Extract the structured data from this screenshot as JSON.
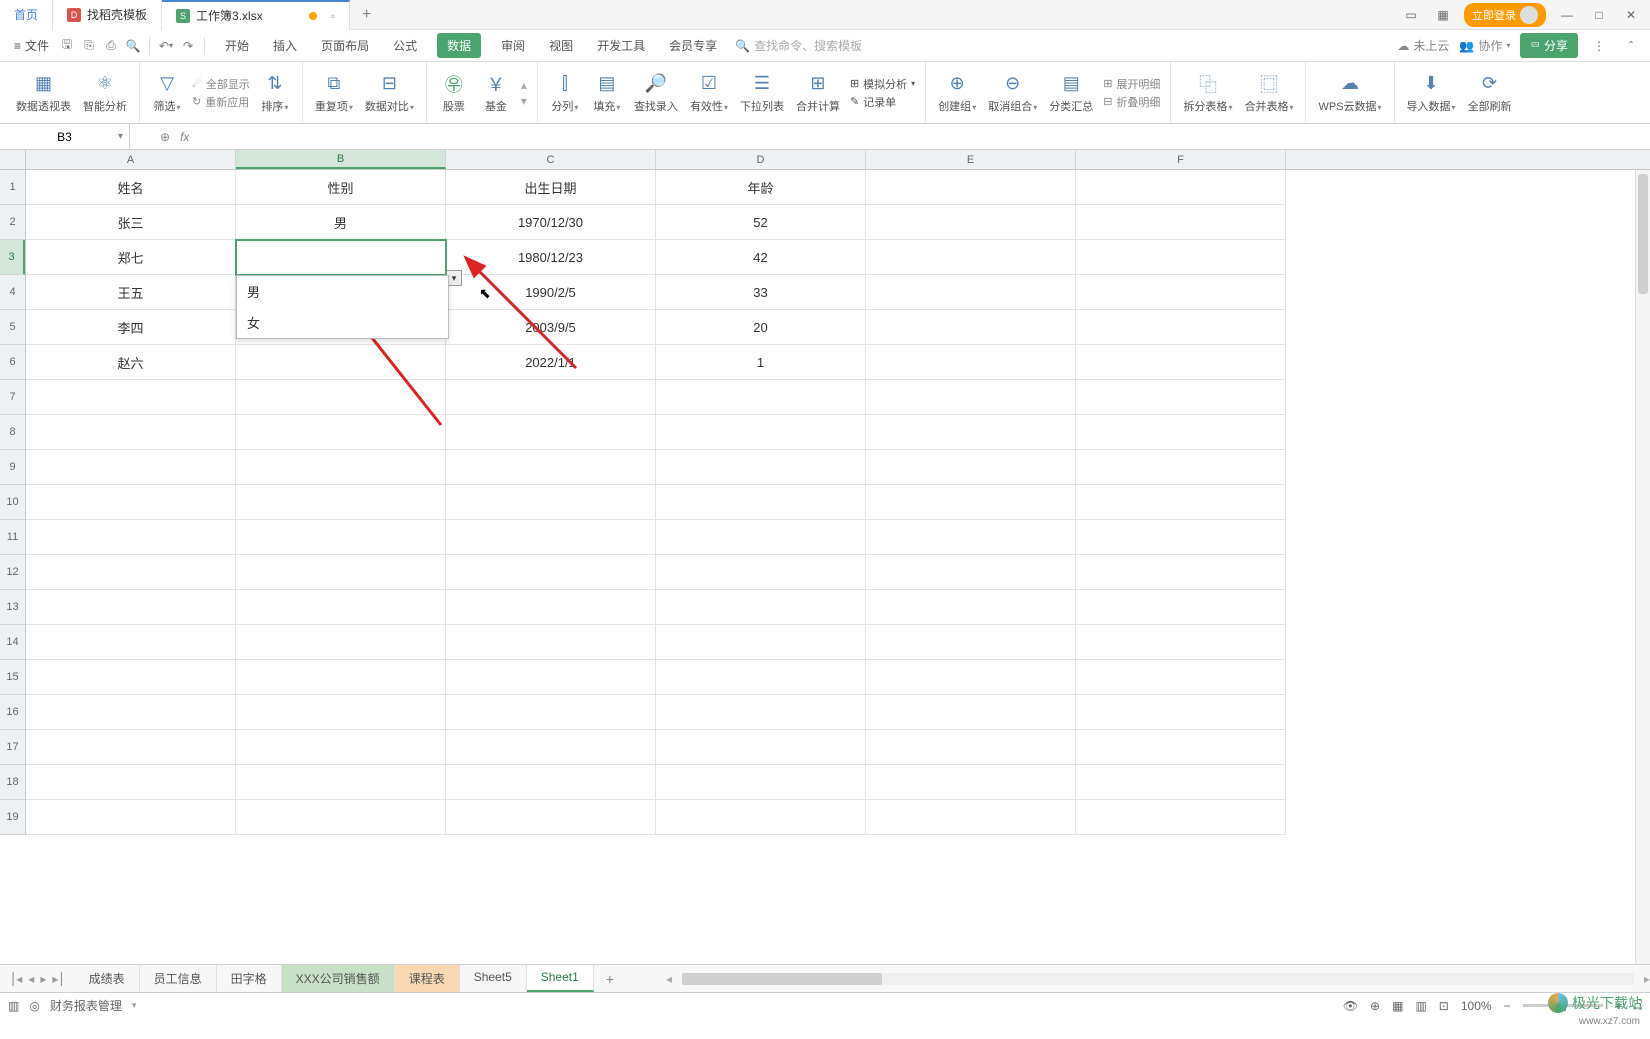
{
  "titlebar": {
    "home_tab": "首页",
    "template_tab": "找稻壳模板",
    "file_tab": "工作簿3.xlsx",
    "login_btn": "立即登录"
  },
  "menubar": {
    "file": "文件",
    "tabs": [
      "开始",
      "插入",
      "页面布局",
      "公式",
      "数据",
      "审阅",
      "视图",
      "开发工具",
      "会员专享"
    ],
    "active_tab_index": 4,
    "search_placeholder": "查找命令、搜索模板",
    "cloud_status": "未上云",
    "coop": "协作",
    "share": "分享"
  },
  "ribbon": {
    "pivot": "数据透视表",
    "smart": "智能分析",
    "filter": "筛选",
    "show_all": "全部显示",
    "reapply": "重新应用",
    "sort": "排序",
    "dup": "重复项",
    "compare": "数据对比",
    "stock": "股票",
    "fund": "基金",
    "split": "分列",
    "fill": "填充",
    "find_entry": "查找录入",
    "validity": "有效性",
    "dropdown_list": "下拉列表",
    "consolidate": "合并计算",
    "scenario": "模拟分析",
    "record": "记录单",
    "group_create": "创建组",
    "group_remove": "取消组合",
    "subtotal": "分类汇总",
    "expand_detail": "展开明细",
    "collapse_detail": "折叠明细",
    "split_table": "拆分表格",
    "merge_table": "合并表格",
    "wps_cloud": "WPS云数据",
    "import_data": "导入数据",
    "refresh_all": "全部刷新"
  },
  "formula_bar": {
    "name_box": "B3"
  },
  "columns": [
    "A",
    "B",
    "C",
    "D",
    "E",
    "F"
  ],
  "selected_col": "B",
  "rows_shown": 19,
  "selected_row": 3,
  "table": {
    "headers": [
      "姓名",
      "性别",
      "出生日期",
      "年龄"
    ],
    "data": [
      [
        "张三",
        "男",
        "1970/12/30",
        "52"
      ],
      [
        "郑七",
        "",
        "1980/12/23",
        "42"
      ],
      [
        "王五",
        "",
        "1990/2/5",
        "33"
      ],
      [
        "李四",
        "",
        "2003/9/5",
        "20"
      ],
      [
        "赵六",
        "",
        "2022/1/1",
        "1"
      ]
    ]
  },
  "dropdown_options": [
    "男",
    "女"
  ],
  "sheet_tabs": {
    "items": [
      "成绩表",
      "员工信息",
      "田字格",
      "XXX公司销售额",
      "课程表",
      "Sheet5",
      "Sheet1"
    ],
    "selected_index": 3,
    "highlight_index": 4,
    "active_index": 6
  },
  "statusbar": {
    "mgmt": "财务报表管理",
    "zoom": "100%"
  },
  "watermark": {
    "name": "极光下载站",
    "url": "www.xz7.com"
  }
}
